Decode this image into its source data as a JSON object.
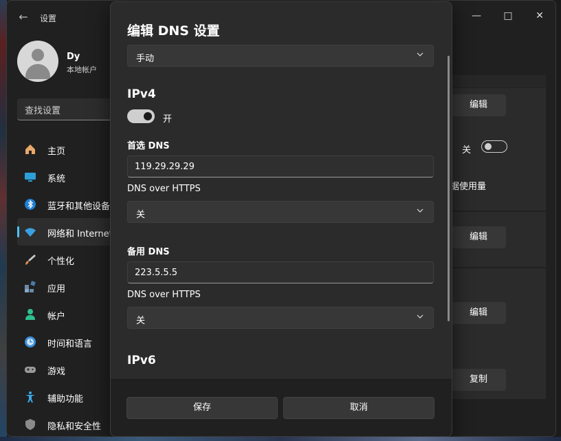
{
  "app": {
    "title": "设置",
    "back_icon": "back-arrow-icon"
  },
  "user": {
    "name": "Dy",
    "account_type": "本地帐户"
  },
  "search": {
    "placeholder": "查找设置"
  },
  "sidebar": {
    "items": [
      {
        "label": "主页",
        "icon": "home-icon",
        "color": "#e8a86a"
      },
      {
        "label": "系统",
        "icon": "system-icon",
        "color": "#2d9fd8"
      },
      {
        "label": "蓝牙和其他设备",
        "icon": "bluetooth-icon",
        "color": "#1e7fd6"
      },
      {
        "label": "网络和 Internet",
        "icon": "network-icon",
        "color": "#3aa0e0",
        "active": true
      },
      {
        "label": "个性化",
        "icon": "brush-icon",
        "color": "#e08a4a"
      },
      {
        "label": "应用",
        "icon": "apps-icon",
        "color": "#6a8aa8"
      },
      {
        "label": "帐户",
        "icon": "account-icon",
        "color": "#2fbf8f"
      },
      {
        "label": "时间和语言",
        "icon": "time-language-icon",
        "color": "#3a8fd8"
      },
      {
        "label": "游戏",
        "icon": "gamepad-icon",
        "color": "#9a9a9a"
      },
      {
        "label": "辅助功能",
        "icon": "accessibility-icon",
        "color": "#3aa8e8"
      },
      {
        "label": "隐私和安全性",
        "icon": "shield-icon",
        "color": "#8a8a8a"
      }
    ]
  },
  "background": {
    "edit1": "编辑",
    "toggle_label": "关",
    "data_usage": "数据使用量",
    "edit2": "编辑",
    "edit3": "编辑",
    "copy": "复制"
  },
  "dialog": {
    "title": "编辑 DNS 设置",
    "mode_value": "手动",
    "ipv4": {
      "heading": "IPv4",
      "toggle_label": "开",
      "preferred_label": "首选 DNS",
      "preferred_value": "119.29.29.29",
      "https1_label": "DNS over HTTPS",
      "https1_value": "关",
      "alternate_label": "备用 DNS",
      "alternate_value": "223.5.5.5",
      "https2_label": "DNS over HTTPS",
      "https2_value": "关"
    },
    "ipv6_heading": "IPv6",
    "save_label": "保存",
    "cancel_label": "取消"
  }
}
